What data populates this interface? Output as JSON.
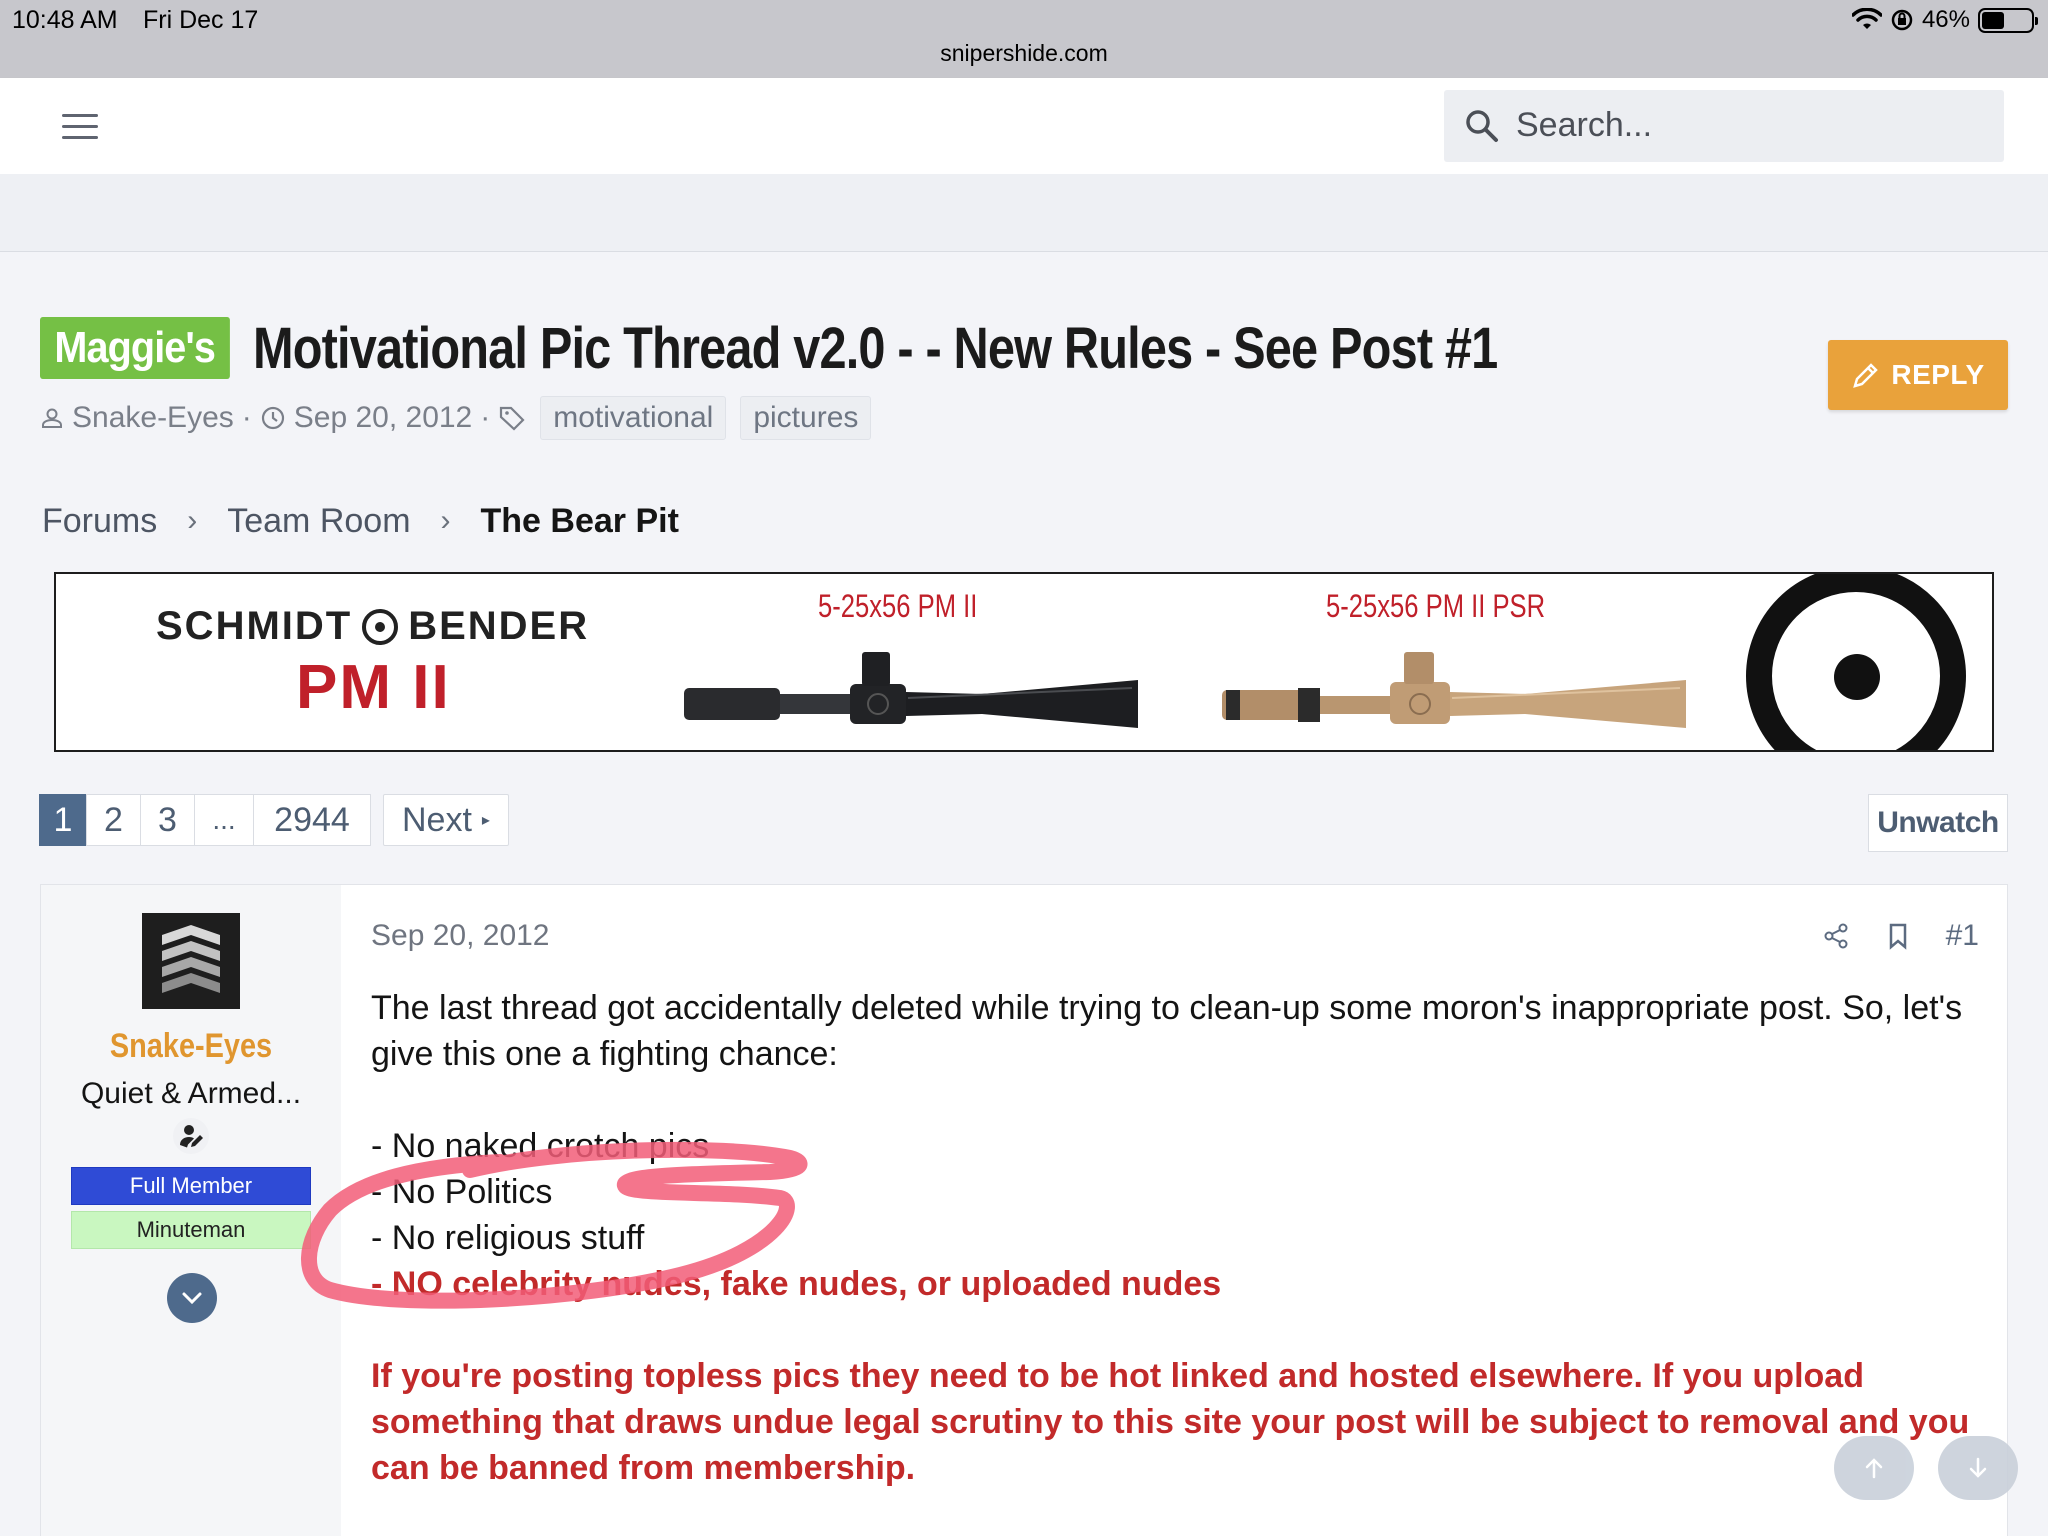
{
  "status_bar": {
    "time": "10:48 AM",
    "date": "Fri Dec 17",
    "url": "snipershide.com",
    "battery": "46%"
  },
  "header": {
    "search_placeholder": "Search..."
  },
  "thread": {
    "prefix": "Maggie's",
    "title": "Motivational Pic Thread v2.0 - - New Rules - See Post #1",
    "author": "Snake-Eyes",
    "date": "Sep 20, 2012",
    "tags": [
      "motivational",
      "pictures"
    ],
    "reply_label": "REPLY"
  },
  "breadcrumb": [
    "Forums",
    "Team Room",
    "The Bear Pit"
  ],
  "banner": {
    "brand": "SCHMIDT",
    "brand2": "BENDER",
    "product": "PM II",
    "scope1": "5-25x56 PM II",
    "scope2": "5-25x56 PM II PSR"
  },
  "pagination": {
    "pages": [
      "1",
      "2",
      "3",
      "...",
      "2944"
    ],
    "current": "1",
    "next_label": "Next",
    "unwatch_label": "Unwatch"
  },
  "post": {
    "username": "Snake-Eyes",
    "user_title": "Quiet & Armed...",
    "badge1": "Full Member",
    "badge2": "Minuteman",
    "date": "Sep 20, 2012",
    "number": "#1",
    "intro": "The last thread got accidentally deleted while trying to clean-up some moron's inappropriate post. So, let's give this one a fighting chance:",
    "rules": [
      "- No naked crotch pics",
      "- No Politics",
      "- No religious stuff"
    ],
    "rule_red": "- NO celebrity nudes, fake nudes, or uploaded nudes",
    "warning": "If you're posting topless pics they need to be hot linked and hosted elsewhere. If you upload something that draws undue legal scrutiny to this site your post will be subject to removal and you can be banned from membership."
  },
  "colors": {
    "prefix_green": "#75c045",
    "reply_orange": "#e9a23b",
    "username_orange": "#e0962f",
    "rule_red": "#c22a2a",
    "badge_blue": "#2f4bd6",
    "badge_green": "#c9f7c0",
    "annotation_pink": "#f25d78"
  }
}
